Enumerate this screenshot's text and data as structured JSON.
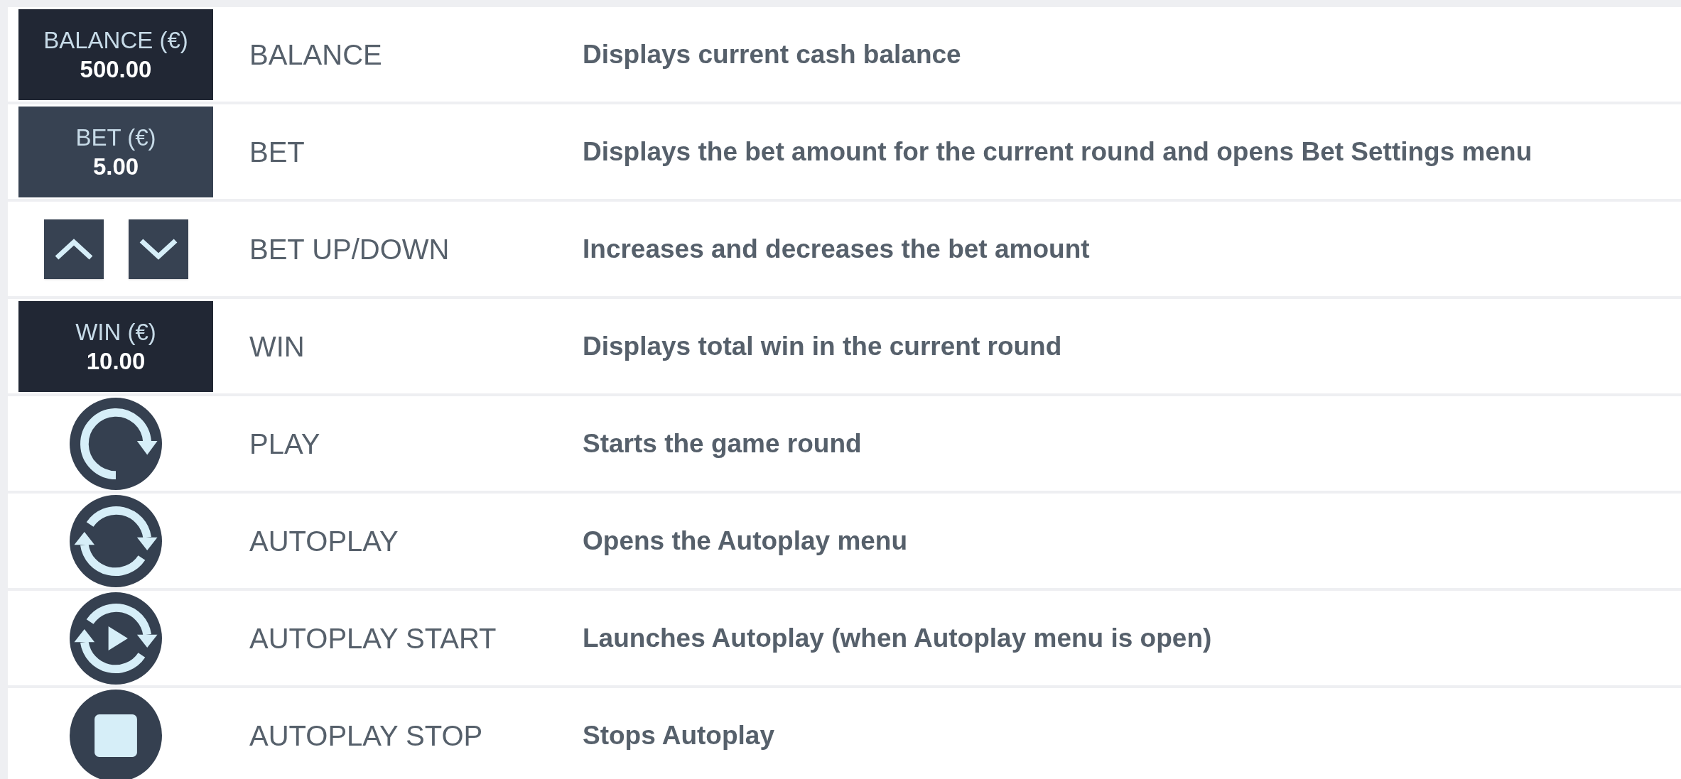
{
  "rows": [
    {
      "control": {
        "kind": "readout",
        "title": "BALANCE (€)",
        "value": "500.00"
      },
      "label": "BALANCE",
      "description": "Displays current cash balance"
    },
    {
      "control": {
        "kind": "bet-button",
        "title": "BET (€)",
        "value": "5.00"
      },
      "label": "BET",
      "description": "Displays the bet amount for the current round and opens Bet Settings menu"
    },
    {
      "control": {
        "kind": "arrows"
      },
      "label": "BET UP/DOWN",
      "description": "Increases and decreases the bet amount"
    },
    {
      "control": {
        "kind": "readout",
        "title": "WIN (€)",
        "value": "10.00"
      },
      "label": "WIN",
      "description": "Displays total win in the current round"
    },
    {
      "control": {
        "kind": "play"
      },
      "label": "PLAY",
      "description": "Starts the game round"
    },
    {
      "control": {
        "kind": "autoplay"
      },
      "label": "AUTOPLAY",
      "description": "Opens the Autoplay menu"
    },
    {
      "control": {
        "kind": "autoplay-start"
      },
      "label": "AUTOPLAY START",
      "description": "Launches Autoplay (when Autoplay menu is open)"
    },
    {
      "control": {
        "kind": "autoplay-stop"
      },
      "label": "AUTOPLAY STOP",
      "description": "Stops Autoplay"
    }
  ]
}
